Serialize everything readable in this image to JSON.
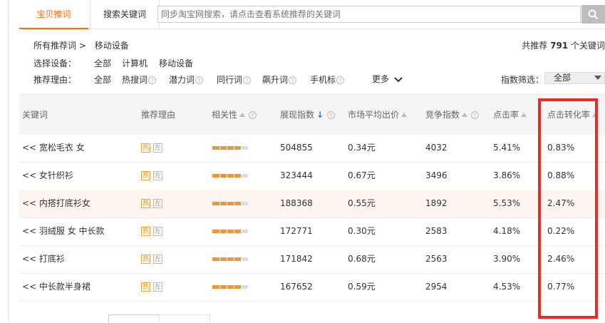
{
  "tabs": [
    {
      "label": "宝贝推词"
    },
    {
      "label": "搜索关键词"
    }
  ],
  "search": {
    "placeholder": "同步淘宝网搜索，请点击查看系统推荐的关键词"
  },
  "breadcrumb": {
    "root": "所有推荐词 >",
    "current": "移动设备"
  },
  "total": {
    "prefix": "共推荐",
    "count": "791",
    "suffix": "个关键词"
  },
  "device": {
    "label": "选择设备：",
    "options": [
      "全部",
      "计算机",
      "移动设备"
    ]
  },
  "reason": {
    "label": "推荐理由：",
    "options": [
      "全部",
      "热搜词",
      "潜力词",
      "同行词",
      "飙升词",
      "手机标"
    ],
    "more": "更多"
  },
  "index_filter": {
    "label": "指数筛选：",
    "value": "全部"
  },
  "columns": [
    "关键词",
    "推荐理由",
    "相关性",
    "展现指数",
    "市场平均出价",
    "竞争指数",
    "点击率",
    "点击转化率"
  ],
  "rows": [
    {
      "keyword": "<< 宽松毛衣 女",
      "tag1": "热",
      "tag2": "左",
      "relevance": 0.8,
      "impressions": "504855",
      "avg_bid": "0.34元",
      "competition": "4032",
      "ctr": "5.41%",
      "cvr": "0.83%"
    },
    {
      "keyword": "<< 女针织衫",
      "tag1": "热",
      "tag2": "左",
      "relevance": 0.8,
      "impressions": "323444",
      "avg_bid": "0.67元",
      "competition": "3496",
      "ctr": "3.86%",
      "cvr": "0.88%"
    },
    {
      "keyword": "<< 内搭打底衫女",
      "tag1": "热",
      "tag2": "左",
      "relevance": 0.8,
      "impressions": "188368",
      "avg_bid": "0.55元",
      "competition": "1892",
      "ctr": "5.53%",
      "cvr": "2.47%"
    },
    {
      "keyword": "<< 羽绒服 女 中长款",
      "tag1": "热",
      "tag2": "左",
      "relevance": 0.8,
      "impressions": "172771",
      "avg_bid": "0.30元",
      "competition": "2583",
      "ctr": "4.18%",
      "cvr": "0.22%"
    },
    {
      "keyword": "<< 打底衫",
      "tag1": "热",
      "tag2": "左",
      "relevance": 0.8,
      "impressions": "171842",
      "avg_bid": "0.68元",
      "competition": "2563",
      "ctr": "3.90%",
      "cvr": "2.46%"
    },
    {
      "keyword": "<< 中长款半身裙",
      "tag1": "热",
      "tag2": "左",
      "relevance": 0.8,
      "impressions": "167652",
      "avg_bid": "0.59元",
      "competition": "2954",
      "ctr": "4.53%",
      "cvr": "0.77%"
    }
  ],
  "colors": {
    "accent": "#ff6a00",
    "highlight": "#f02828",
    "bar": "#f29633"
  }
}
